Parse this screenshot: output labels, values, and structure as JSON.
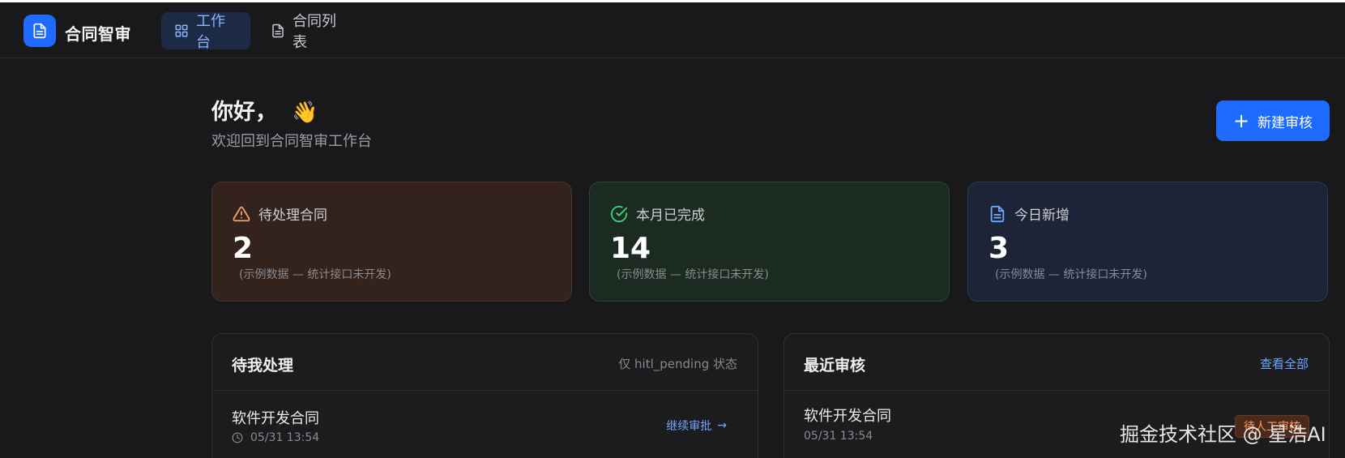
{
  "app": {
    "title": "合同智审"
  },
  "nav": {
    "tabs": [
      {
        "label": "工作台",
        "active": true,
        "icon": "grid-icon"
      },
      {
        "label": "合同列表",
        "active": false,
        "icon": "document-icon"
      }
    ]
  },
  "greeting": {
    "title": "你好，",
    "emoji": "👋",
    "subtitle": "欢迎回到合同智审工作台"
  },
  "actions": {
    "new_review": "新建审核"
  },
  "stats": [
    {
      "label": "待处理合同",
      "value": "2",
      "note": "(示例数据 — 统计接口未开发)",
      "icon": "warning-icon",
      "color": "#f5a06e"
    },
    {
      "label": "本月已完成",
      "value": "14",
      "note": "(示例数据 — 统计接口未开发)",
      "icon": "check-circle-icon",
      "color": "#3fd07a"
    },
    {
      "label": "今日新增",
      "value": "3",
      "note": "(示例数据 — 统计接口未开发)",
      "icon": "document-icon",
      "color": "#6ea6ff"
    }
  ],
  "todo": {
    "title": "待我处理",
    "hint": "仅 hitl_pending 状态",
    "items": [
      {
        "name": "软件开发合同",
        "time": "05/31 13:54",
        "action": "继续审批",
        "arrow": "→"
      }
    ]
  },
  "recent": {
    "title": "最近审核",
    "link": "查看全部",
    "items": [
      {
        "name": "软件开发合同",
        "time": "05/31 13:54",
        "status": "待人工审核"
      }
    ]
  },
  "watermark": "掘金技术社区 @ 星浩AI",
  "colors": {
    "accent": "#1f6bff",
    "link": "#6ea6ff",
    "background": "#19191b"
  }
}
